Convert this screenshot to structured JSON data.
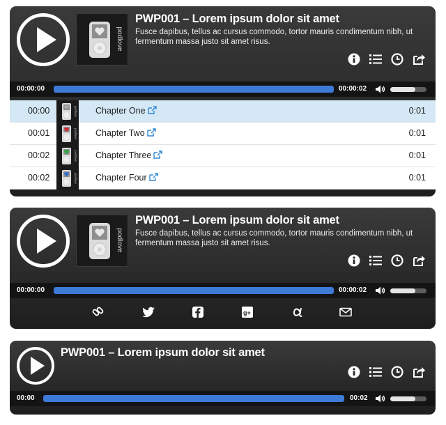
{
  "players": [
    {
      "title": "PWP001 – Lorem ipsum dolor sit amet",
      "subtitle": "Fusce dapibus, tellus ac cursus commodo, tortor mauris condimentum nibh, ut fermentum massa justo sit amet risus.",
      "current_time": "00:00:00",
      "duration": "00:00:02",
      "progress": 0,
      "volume": 0.7,
      "cover_text": "podlove",
      "chapters": [
        {
          "start": "00:00",
          "title": "Chapter One",
          "duration": "0:01",
          "heart_color": "#aaaaaa"
        },
        {
          "start": "00:01",
          "title": "Chapter Two",
          "duration": "0:01",
          "heart_color": "#d0272b"
        },
        {
          "start": "00:02",
          "title": "Chapter Three",
          "duration": "0:01",
          "heart_color": "#27a83c"
        },
        {
          "start": "00:02",
          "title": "Chapter Four",
          "duration": "0:01",
          "heart_color": "#2f6fd1"
        }
      ]
    },
    {
      "title": "PWP001 – Lorem ipsum dolor sit amet",
      "subtitle": "Fusce dapibus, tellus ac cursus commodo, tortor mauris condimentum nibh, ut fermentum massa justo sit amet risus.",
      "current_time": "00:00:00",
      "duration": "00:00:02",
      "progress": 0,
      "volume": 0.7,
      "cover_text": "podlove",
      "share_icons": [
        "link-icon",
        "twitter-icon",
        "facebook-icon",
        "google-plus-icon",
        "app-net-icon",
        "email-icon"
      ]
    },
    {
      "title": "PWP001 – Lorem ipsum dolor sit amet",
      "current_time": "00:00",
      "duration": "00:02",
      "progress": 0,
      "volume": 0.7
    }
  ],
  "colors": {
    "accent": "#3e7ad8",
    "player_bg": "#2b2b2b",
    "active_chapter_bg": "#d4e8f5",
    "link_blue": "#2f87d6"
  }
}
